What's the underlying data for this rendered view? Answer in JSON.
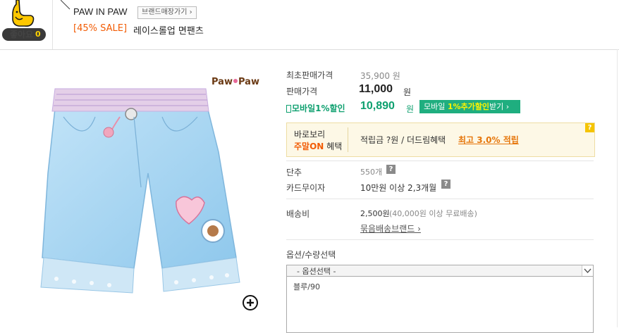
{
  "header": {
    "like_label": "좋아요",
    "like_count": "0",
    "brand_name": "PAW IN PAW",
    "brand_shop_button": "브랜드매장가기 ›",
    "sale_tag": "[45% SALE]",
    "product_name": "레이스롤업 면팬츠"
  },
  "image": {
    "logo_text": "Paw Paw",
    "logo_icon": "paw-icon",
    "zoom_icon": "zoom-plus-icon"
  },
  "price": {
    "original_label": "최초판매가격",
    "original_value": "35,900 원",
    "sale_label": "판매가격",
    "sale_value": "11,000",
    "sale_unit": "원",
    "mobile_label": "모바일1%할인",
    "mobile_value": "10,890",
    "mobile_unit": "원",
    "mobile_btn_prefix": "모바일",
    "mobile_btn_highlight": "1%추가할인",
    "mobile_btn_suffix": "받기 ›"
  },
  "benefit": {
    "title_line1": "바로보리",
    "title_line2_hl": "주말ON",
    "title_line2": "혜택",
    "text": "적립금 ?원 / 더드림혜택",
    "link": "최고 3.0% 적립",
    "help": "?"
  },
  "info": {
    "stock_label": "단추",
    "stock_value": "550개",
    "card_label": "카드무이자",
    "card_value": "10만원 이상 2,3개월",
    "shipping_label": "배송비",
    "shipping_value": "2,500원",
    "shipping_note": "(40,000원 이상 무료배송)",
    "bundle_link": "묶음배송브랜드 ›",
    "help": "?"
  },
  "options": {
    "label": "옵션/수량선택",
    "select_value": "- 옵션선택 -",
    "items": [
      "블루/90"
    ]
  },
  "colors": {
    "accent_orange": "#f25c05",
    "mobile_green": "#1fae7f",
    "benefit_bg": "#fdf8e6",
    "link_orange": "#e6760b"
  }
}
